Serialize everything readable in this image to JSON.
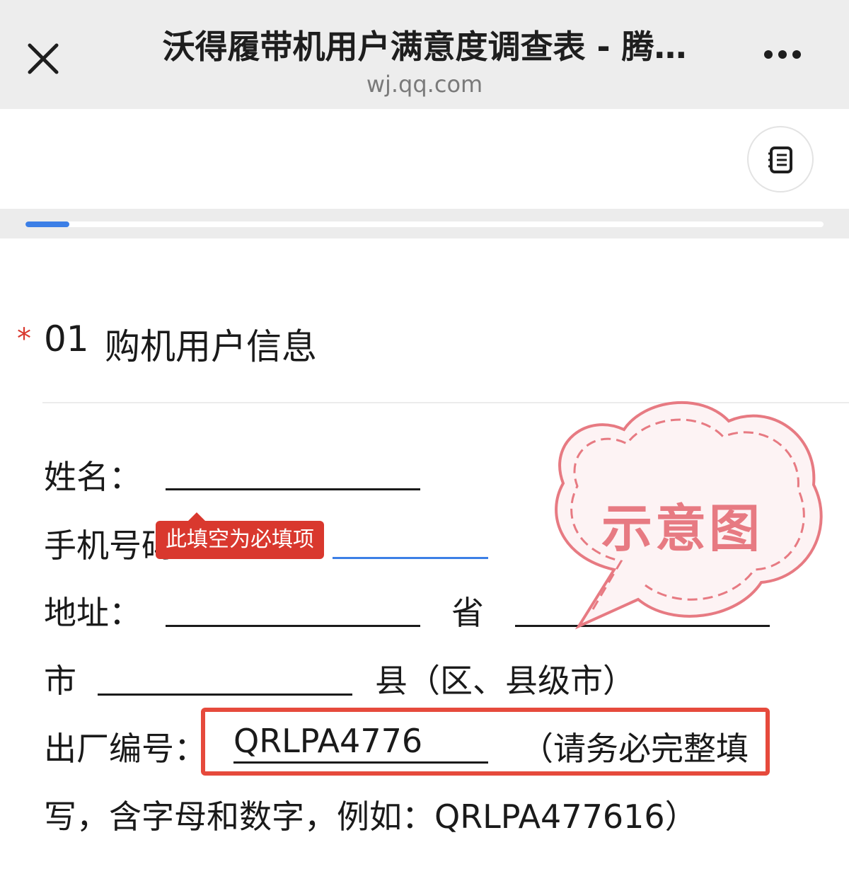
{
  "header": {
    "title": "沃得履带机用户满意度调查表 - 腾…",
    "url": "wj.qq.com"
  },
  "progress": {
    "fraction": 0.055
  },
  "question": {
    "required_mark": "*",
    "number": "01",
    "title": "购机用户信息"
  },
  "form": {
    "name_label": "姓名：",
    "phone_label": "手机号码",
    "address_label": "地址：",
    "province_label": "省",
    "city_label": "市",
    "county_label": "县（区、县级市）",
    "serial_label": "出厂编号：",
    "serial_value": "QRLPA4776",
    "serial_hint_1": "（请务必完整填",
    "serial_hint_2": "写，含字母和数字，例如：QRLPA477616）",
    "required_tooltip": "此填空为必填项"
  },
  "stamp": {
    "text": "示意图"
  },
  "colors": {
    "accent_blue": "#3c7fe6",
    "required_red": "#d9382e",
    "highlight_red": "#e64a3c",
    "stamp_pink": "#e77a82"
  },
  "icons": [
    "close-icon",
    "more-icon",
    "catalog-list-icon"
  ]
}
